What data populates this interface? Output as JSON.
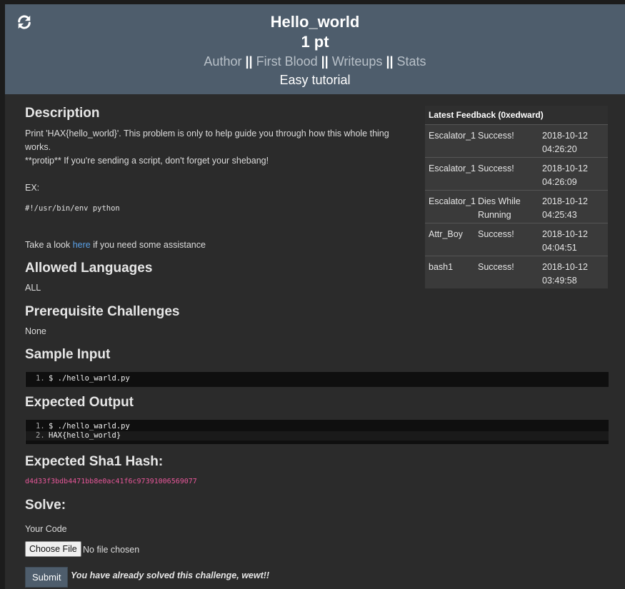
{
  "header": {
    "title": "Hello_world",
    "points": "1 pt",
    "links": [
      "Author",
      "First Blood",
      "Writeups",
      "Stats"
    ],
    "separator": "||",
    "subtitle": "Easy tutorial",
    "refresh_icon": "refresh-icon"
  },
  "description": {
    "heading": "Description",
    "line1": "Print 'HAX{hello_world}'. This problem is only to help guide you through how this whole thing works.",
    "line2": "**protip** If you're sending a script, don't forget your shebang!",
    "ex_label": "EX:",
    "shebang": "#!/usr/bin/env python",
    "help_prefix": "Take a look ",
    "help_link": "here",
    "help_suffix": " if you need some assistance"
  },
  "allowed_languages": {
    "heading": "Allowed Languages",
    "value": "ALL"
  },
  "prerequisites": {
    "heading": "Prerequisite Challenges",
    "value": "None"
  },
  "sample_input": {
    "heading": "Sample Input",
    "lines": [
      {
        "num": "1.",
        "text": "$ ./hello_warld.py"
      }
    ]
  },
  "expected_output": {
    "heading": "Expected Output",
    "lines": [
      {
        "num": "1.",
        "text": "$ ./hello_warld.py"
      },
      {
        "num": "2.",
        "text": "HAX{hello_world}"
      }
    ]
  },
  "hash": {
    "heading": "Expected Sha1 Hash:",
    "value": "d4d33f3bdb4471bb8e0ac41f6c97391006569077"
  },
  "solve": {
    "heading": "Solve:",
    "code_label": "Your Code",
    "choose_file": "Choose File",
    "no_file": "No file chosen",
    "submit": "Submit",
    "solved_message": "You have already solved this challenge, wewt!!"
  },
  "feedback": {
    "title": "Latest Feedback (0xedward)",
    "rows": [
      {
        "user": "Escalator_1",
        "result": "Success!",
        "date": "2018-10-12",
        "time": "04:26:20"
      },
      {
        "user": "Escalator_1",
        "result": "Success!",
        "date": "2018-10-12",
        "time": "04:26:09"
      },
      {
        "user": "Escalator_1",
        "result": "Dies While Running",
        "date": "2018-10-12",
        "time": "04:25:43"
      },
      {
        "user": "Attr_Boy",
        "result": "Success!",
        "date": "2018-10-12",
        "time": "04:04:51"
      },
      {
        "user": "bash1",
        "result": "Success!",
        "date": "2018-10-12",
        "time": "03:49:58"
      }
    ]
  }
}
